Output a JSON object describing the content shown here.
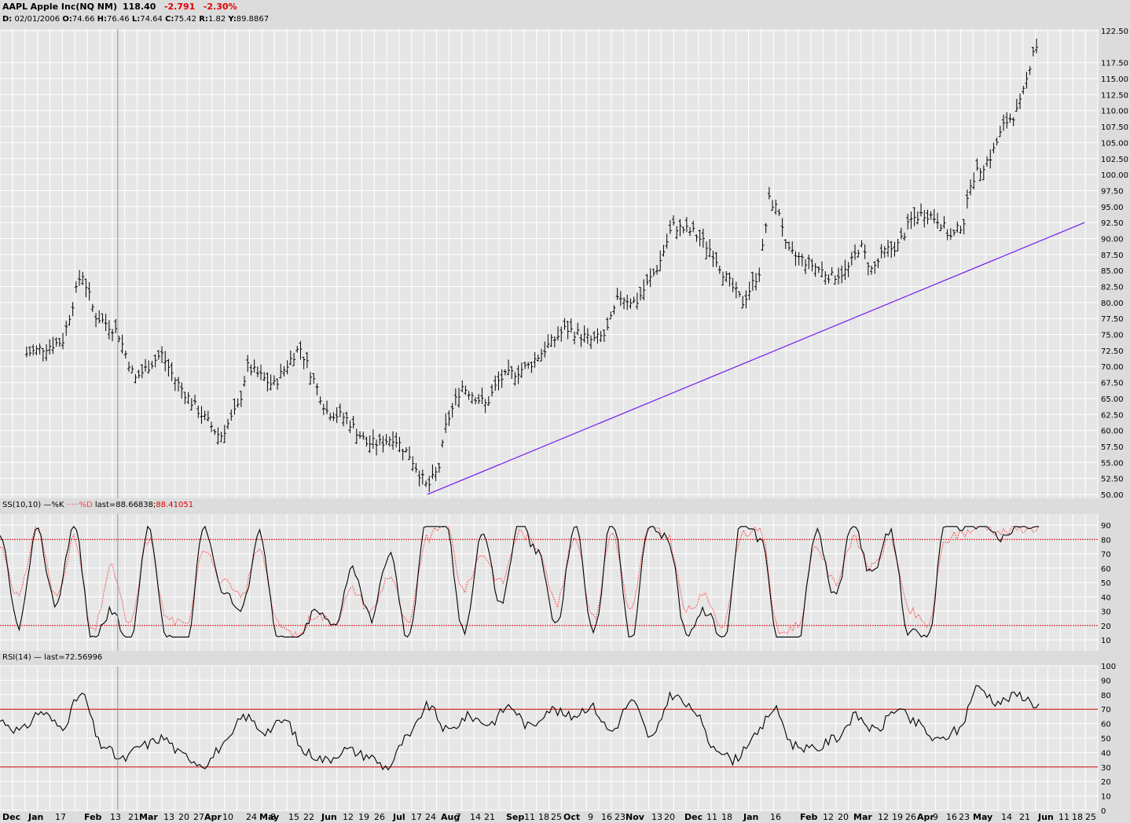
{
  "header": {
    "symbol": "AAPL",
    "name": "Apple Inc(NQ NM)",
    "last": "118.40",
    "change": "-2.791",
    "change_pct": "-2.30%",
    "data_line": {
      "date_label": "D:",
      "date": "02/01/2006",
      "open_label": "O:",
      "open": "74.66",
      "high_label": "H:",
      "high": "76.46",
      "low_label": "L:",
      "low": "74.64",
      "close_label": "C:",
      "close": "75.42",
      "r_label": "R:",
      "r": "1.82",
      "y_label": "Y:",
      "y": "89.8867"
    }
  },
  "colors": {
    "background": "#dcdcdc",
    "plot_bg": "#e6e6e6",
    "grid": "#ffffff",
    "bars": "#000000",
    "trendline": "#7b2cf0",
    "k_line": "#000000",
    "d_line": "#ff4040",
    "threshold": "#cc0000",
    "cursor": "#7f9f9f"
  },
  "price_panel": {
    "y_ticks": [
      "122.50",
      "117.50",
      "115.00",
      "112.50",
      "110.00",
      "107.50",
      "105.00",
      "102.50",
      "100.00",
      "97.50",
      "95.00",
      "92.50",
      "90.00",
      "87.50",
      "85.00",
      "82.50",
      "80.00",
      "77.50",
      "75.00",
      "72.50",
      "70.00",
      "67.50",
      "65.00",
      "62.50",
      "60.00",
      "57.50",
      "55.00",
      "52.50",
      "50.00"
    ]
  },
  "stoch_panel": {
    "label": "SS(10,10)",
    "k_name": "%K",
    "d_name": "%D",
    "last_label": "last=",
    "k_last": "88.66838",
    "d_last": "88.41051",
    "y_ticks": [
      "90",
      "80",
      "70",
      "60",
      "50",
      "40",
      "30",
      "20",
      "10"
    ],
    "upper": 80,
    "lower": 20
  },
  "rsi_panel": {
    "label": "RSI(14)",
    "last_label": "last=",
    "last": "72.56996",
    "y_ticks": [
      "100",
      "90",
      "80",
      "70",
      "60",
      "50",
      "40",
      "30",
      "20",
      "10",
      "0"
    ],
    "upper": 70,
    "lower": 30
  },
  "x_axis_labels": [
    {
      "t": "Dec",
      "b": true
    },
    {
      "t": "Jan",
      "b": true
    },
    {
      "t": "17",
      "b": false
    },
    {
      "t": "Feb",
      "b": true
    },
    {
      "t": "13",
      "b": false
    },
    {
      "t": "21",
      "b": false
    },
    {
      "t": "Mar",
      "b": true
    },
    {
      "t": "13",
      "b": false
    },
    {
      "t": "20",
      "b": false
    },
    {
      "t": "27",
      "b": false
    },
    {
      "t": "Apr",
      "b": true
    },
    {
      "t": "10",
      "b": false
    },
    {
      "t": "24",
      "b": false
    },
    {
      "t": "May",
      "b": true
    },
    {
      "t": "8",
      "b": false
    },
    {
      "t": "15",
      "b": false
    },
    {
      "t": "22",
      "b": false
    },
    {
      "t": "Jun",
      "b": true
    },
    {
      "t": "12",
      "b": false
    },
    {
      "t": "19",
      "b": false
    },
    {
      "t": "26",
      "b": false
    },
    {
      "t": "Jul",
      "b": true
    },
    {
      "t": "17",
      "b": false
    },
    {
      "t": "24",
      "b": false
    },
    {
      "t": "Aug",
      "b": true
    },
    {
      "t": "7",
      "b": false
    },
    {
      "t": "14",
      "b": false
    },
    {
      "t": "21",
      "b": false
    },
    {
      "t": "Sep",
      "b": true
    },
    {
      "t": "11",
      "b": false
    },
    {
      "t": "18",
      "b": false
    },
    {
      "t": "25",
      "b": false
    },
    {
      "t": "Oct",
      "b": true
    },
    {
      "t": "9",
      "b": false
    },
    {
      "t": "16",
      "b": false
    },
    {
      "t": "23",
      "b": false
    },
    {
      "t": "Nov",
      "b": true
    },
    {
      "t": "13",
      "b": false
    },
    {
      "t": "20",
      "b": false
    },
    {
      "t": "Dec",
      "b": true
    },
    {
      "t": "11",
      "b": false
    },
    {
      "t": "18",
      "b": false
    },
    {
      "t": "Jan",
      "b": true
    },
    {
      "t": "16",
      "b": false
    },
    {
      "t": "Feb",
      "b": true
    },
    {
      "t": "12",
      "b": false
    },
    {
      "t": "20",
      "b": false
    },
    {
      "t": "Mar",
      "b": true
    },
    {
      "t": "12",
      "b": false
    },
    {
      "t": "19",
      "b": false
    },
    {
      "t": "26",
      "b": false
    },
    {
      "t": "Apr",
      "b": true
    },
    {
      "t": "9",
      "b": false
    },
    {
      "t": "16",
      "b": false
    },
    {
      "t": "23",
      "b": false
    },
    {
      "t": "May",
      "b": true
    },
    {
      "t": "14",
      "b": false
    },
    {
      "t": "21",
      "b": false
    },
    {
      "t": "Jun",
      "b": true
    },
    {
      "t": "11",
      "b": false
    },
    {
      "t": "18",
      "b": false
    },
    {
      "t": "25",
      "b": false
    }
  ],
  "chart_data": [
    {
      "type": "bar",
      "subtype": "ohlc",
      "ylim": [
        50,
        122.5
      ],
      "x_range": [
        "Dec 2005",
        "Jun 2007"
      ],
      "grid": true,
      "anchors": [
        {
          "date": "2005-12",
          "close": 72
        },
        {
          "date": "2006-01-03",
          "close": 74
        },
        {
          "date": "2006-01-13",
          "close": 85
        },
        {
          "date": "2006-01-20",
          "close": 78
        },
        {
          "date": "2006-02-01",
          "close": 75.42
        },
        {
          "date": "2006-02-10",
          "close": 68
        },
        {
          "date": "2006-02-17",
          "close": 70
        },
        {
          "date": "2006-02-24",
          "close": 72
        },
        {
          "date": "2006-03-03",
          "close": 68
        },
        {
          "date": "2006-03-13",
          "close": 64
        },
        {
          "date": "2006-03-27",
          "close": 59
        },
        {
          "date": "2006-04-06",
          "close": 64
        },
        {
          "date": "2006-04-10",
          "close": 70
        },
        {
          "date": "2006-04-24",
          "close": 67
        },
        {
          "date": "2006-05-05",
          "close": 72
        },
        {
          "date": "2006-05-08",
          "close": 73
        },
        {
          "date": "2006-05-22",
          "close": 63
        },
        {
          "date": "2006-06-01",
          "close": 62
        },
        {
          "date": "2006-06-12",
          "close": 58
        },
        {
          "date": "2006-06-19",
          "close": 58
        },
        {
          "date": "2006-06-26",
          "close": 59
        },
        {
          "date": "2006-07-05",
          "close": 56
        },
        {
          "date": "2006-07-14",
          "close": 51
        },
        {
          "date": "2006-07-20",
          "close": 54
        },
        {
          "date": "2006-07-24",
          "close": 61
        },
        {
          "date": "2006-08-01",
          "close": 67
        },
        {
          "date": "2006-08-14",
          "close": 64
        },
        {
          "date": "2006-08-21",
          "close": 68
        },
        {
          "date": "2006-09-05",
          "close": 70
        },
        {
          "date": "2006-09-18",
          "close": 74
        },
        {
          "date": "2006-09-25",
          "close": 76
        },
        {
          "date": "2006-10-09",
          "close": 74
        },
        {
          "date": "2006-10-16",
          "close": 75
        },
        {
          "date": "2006-10-23",
          "close": 81
        },
        {
          "date": "2006-11-01",
          "close": 80
        },
        {
          "date": "2006-11-13",
          "close": 86
        },
        {
          "date": "2006-11-20",
          "close": 92
        },
        {
          "date": "2006-12-01",
          "close": 91
        },
        {
          "date": "2006-12-11",
          "close": 88
        },
        {
          "date": "2006-12-18",
          "close": 84
        },
        {
          "date": "2006-12-27",
          "close": 80
        },
        {
          "date": "2007-01-05",
          "close": 85
        },
        {
          "date": "2007-01-10",
          "close": 96
        },
        {
          "date": "2007-01-16",
          "close": 94
        },
        {
          "date": "2007-01-19",
          "close": 88
        },
        {
          "date": "2007-02-01",
          "close": 86
        },
        {
          "date": "2007-02-12",
          "close": 84
        },
        {
          "date": "2007-02-20",
          "close": 85
        },
        {
          "date": "2007-02-27",
          "close": 89
        },
        {
          "date": "2007-03-05",
          "close": 85
        },
        {
          "date": "2007-03-12",
          "close": 88
        },
        {
          "date": "2007-03-19",
          "close": 89
        },
        {
          "date": "2007-03-26",
          "close": 93
        },
        {
          "date": "2007-04-02",
          "close": 94
        },
        {
          "date": "2007-04-09",
          "close": 93
        },
        {
          "date": "2007-04-16",
          "close": 90
        },
        {
          "date": "2007-04-23",
          "close": 93
        },
        {
          "date": "2007-04-26",
          "close": 99
        },
        {
          "date": "2007-05-07",
          "close": 103
        },
        {
          "date": "2007-05-14",
          "close": 108
        },
        {
          "date": "2007-05-21",
          "close": 110
        },
        {
          "date": "2007-05-25",
          "close": 114
        },
        {
          "date": "2007-05-30",
          "close": 121
        },
        {
          "date": "2007-06-01",
          "close": 118.4
        }
      ],
      "trendline": [
        {
          "date": "2006-07-14",
          "value": 50
        },
        {
          "date": "2007-06-25",
          "value": 92.5
        }
      ]
    },
    {
      "type": "line",
      "name": "SS(10,10)",
      "ylim": [
        0,
        100
      ],
      "series": [
        {
          "name": "%K",
          "values": [
            80,
            20,
            85,
            35,
            90,
            10,
            30,
            5,
            88,
            10,
            5,
            90,
            45,
            30,
            85,
            10,
            8,
            30,
            20,
            60,
            25,
            70,
            10,
            95,
            90,
            15,
            85,
            35,
            92,
            70,
            20,
            90,
            15,
            95,
            10,
            92,
            80,
            15,
            30,
            10,
            95,
            80,
            5,
            10,
            85,
            40,
            90,
            55,
            85,
            15,
            10,
            95,
            88,
            92,
            80,
            90,
            88
          ]
        },
        {
          "name": "%D",
          "values": [
            75,
            40,
            88,
            40,
            80,
            15,
            60,
            20,
            80,
            25,
            20,
            75,
            50,
            40,
            75,
            20,
            12,
            28,
            22,
            45,
            30,
            55,
            20,
            80,
            92,
            45,
            70,
            50,
            85,
            75,
            35,
            82,
            25,
            85,
            30,
            88,
            82,
            30,
            40,
            20,
            85,
            85,
            15,
            20,
            75,
            50,
            80,
            60,
            80,
            30,
            20,
            80,
            85,
            90,
            85,
            88,
            88
          ]
        }
      ],
      "thresholds": [
        80,
        20
      ]
    },
    {
      "type": "line",
      "name": "RSI(14)",
      "ylim": [
        0,
        100
      ],
      "series": [
        {
          "name": "RSI",
          "values": [
            62,
            55,
            68,
            58,
            80,
            45,
            35,
            45,
            50,
            38,
            32,
            45,
            65,
            55,
            62,
            40,
            35,
            42,
            38,
            30,
            50,
            72,
            55,
            65,
            60,
            72,
            58,
            70,
            65,
            72,
            55,
            75,
            50,
            80,
            70,
            45,
            35,
            50,
            70,
            45,
            42,
            50,
            65,
            55,
            70,
            60,
            48,
            55,
            85,
            75,
            80,
            72.57
          ]
        }
      ],
      "thresholds": [
        70,
        30
      ]
    }
  ]
}
